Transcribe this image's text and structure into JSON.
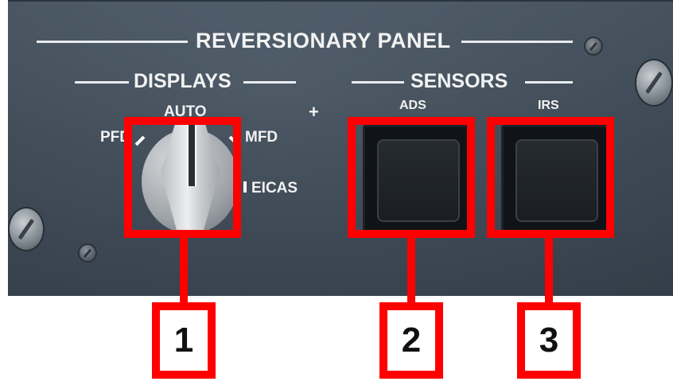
{
  "panel": {
    "title": "REVERSIONARY PANEL",
    "displays_header": "DISPLAYS",
    "sensors_header": "SENSORS",
    "plus_mark": "+"
  },
  "displays_selector": {
    "positions": {
      "auto": "AUTO",
      "pfd": "PFD",
      "mfd": "MFD",
      "eicas": "EICAS"
    }
  },
  "sensor_buttons": [
    {
      "label": "ADS"
    },
    {
      "label": "IRS"
    }
  ],
  "callouts": [
    {
      "number": "1"
    },
    {
      "number": "2"
    },
    {
      "number": "3"
    }
  ],
  "colors": {
    "panel": "#3f4c59",
    "callout": "#ff0000",
    "label": "#f2f2f2"
  }
}
